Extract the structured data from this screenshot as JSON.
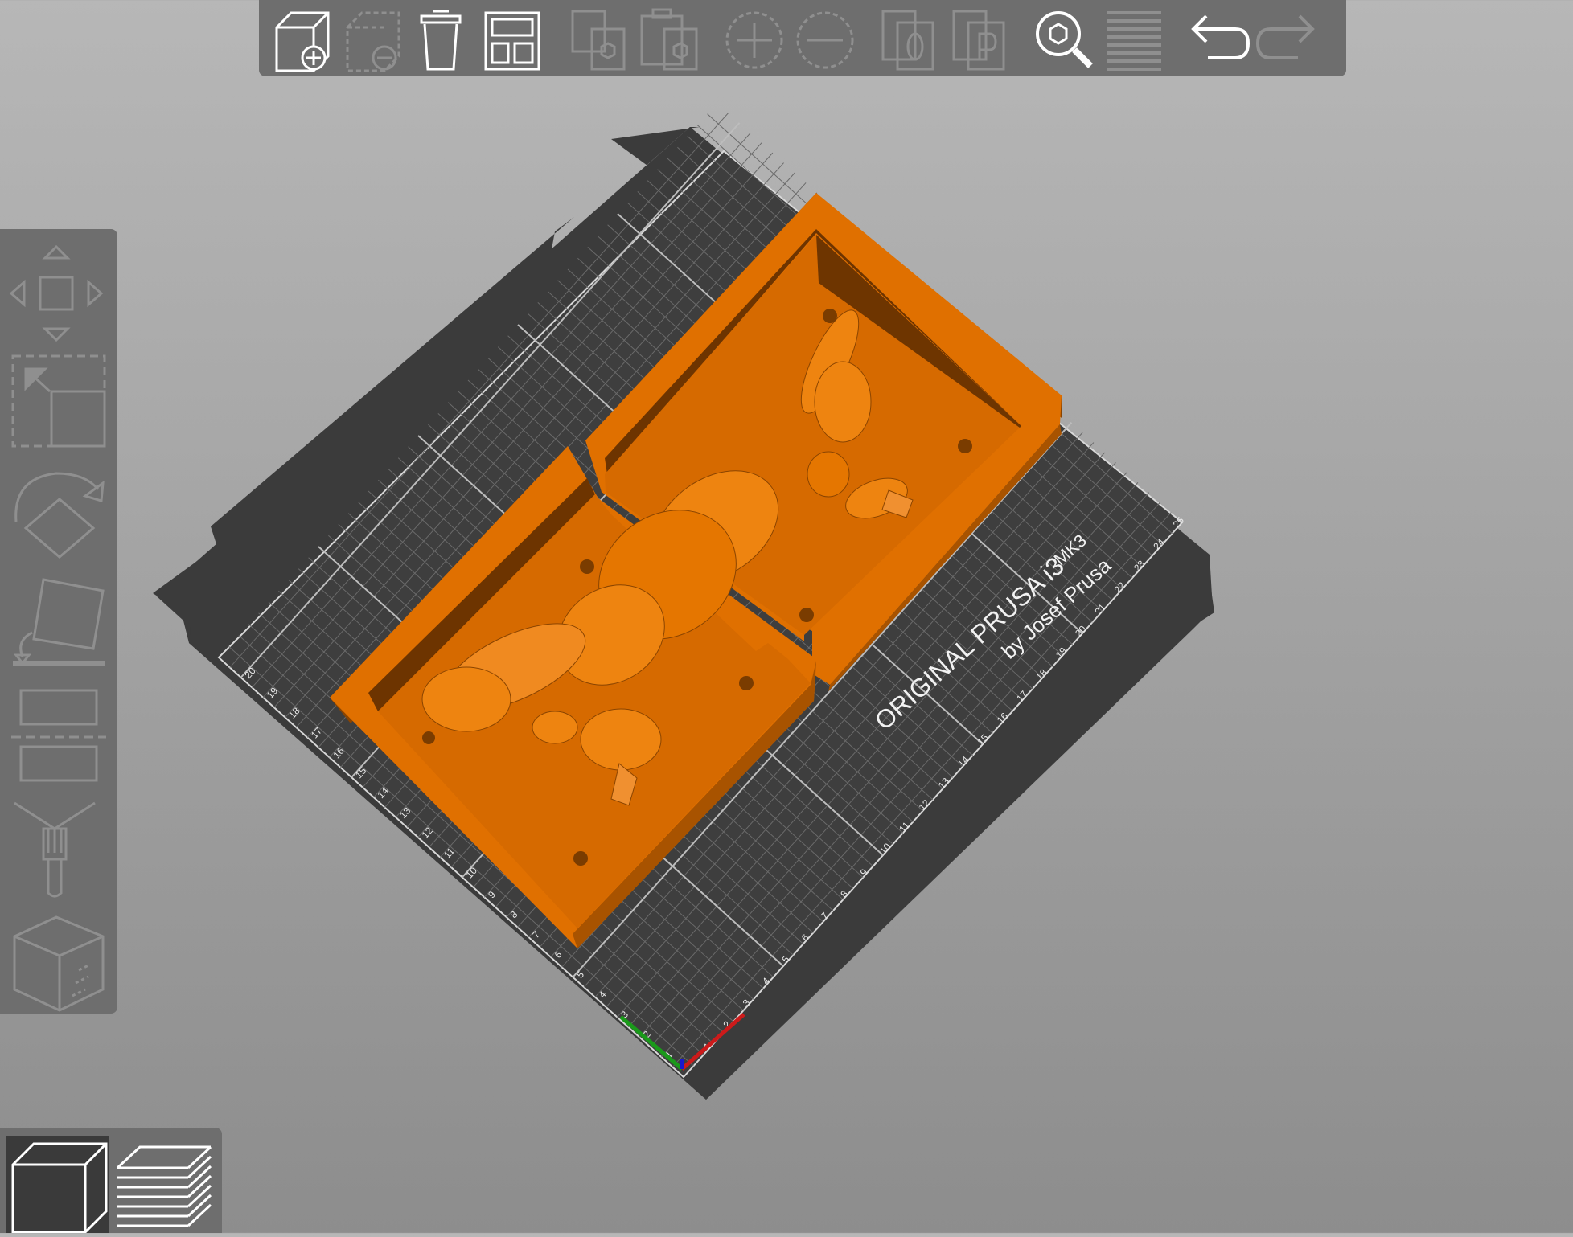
{
  "app": {
    "accent_color": "#e07000",
    "bed_color": "#3b3b3b"
  },
  "top_toolbar": {
    "buttons": [
      {
        "icon": "add-object-icon",
        "enabled": true
      },
      {
        "icon": "delete-object-icon",
        "enabled": false
      },
      {
        "icon": "delete-all-icon",
        "enabled": true
      },
      {
        "icon": "arrange-icon",
        "enabled": true
      },
      {
        "icon": "copy-icon",
        "enabled": false
      },
      {
        "icon": "paste-icon",
        "enabled": false
      },
      {
        "icon": "add-instance-icon",
        "enabled": false
      },
      {
        "icon": "remove-instance-icon",
        "enabled": false
      },
      {
        "icon": "split-to-objects-icon",
        "enabled": false
      },
      {
        "icon": "split-to-parts-icon",
        "enabled": false
      },
      {
        "icon": "search-icon",
        "enabled": true
      },
      {
        "icon": "layers-editing-icon",
        "enabled": false
      },
      {
        "icon": "undo-icon",
        "enabled": true
      },
      {
        "icon": "redo-icon",
        "enabled": false
      }
    ]
  },
  "left_toolbar": {
    "tools": [
      "move-icon",
      "scale-icon",
      "rotate-icon",
      "place-on-face-icon",
      "cut-icon",
      "paint-supports-icon",
      "seam-painting-icon"
    ]
  },
  "bottom_toolbar": {
    "views": [
      {
        "icon": "3d-view-icon",
        "active": true
      },
      {
        "icon": "preview-layers-icon",
        "active": false
      }
    ]
  },
  "scene": {
    "bed_label_line1": "ORIGINAL PRUSA i3",
    "bed_label_mk": "MK3",
    "bed_label_line2": "by Josef Prusa",
    "x_ticks": [
      "1",
      "2",
      "3",
      "4",
      "5",
      "6",
      "7",
      "8",
      "9",
      "10",
      "11",
      "12",
      "13",
      "14",
      "15",
      "16",
      "17",
      "18",
      "19",
      "20",
      "21",
      "22",
      "23",
      "24",
      "25"
    ],
    "y_ticks": [
      "1",
      "2",
      "3",
      "4",
      "5",
      "6",
      "7",
      "8",
      "9",
      "10",
      "11",
      "12",
      "13",
      "14",
      "15",
      "16",
      "17",
      "18",
      "19",
      "20"
    ]
  }
}
